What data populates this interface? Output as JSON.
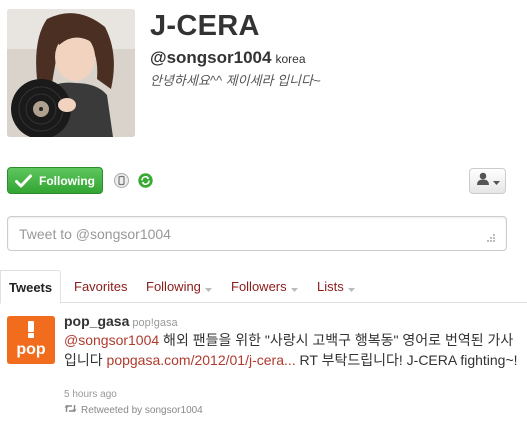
{
  "profile": {
    "name": "J-CERA",
    "handle": "@songsor1004",
    "location": "korea",
    "bio": "안녕하세요^^ 제이세라 입니다~"
  },
  "actions": {
    "follow_label": "Following",
    "follow_color": "#3aaa35"
  },
  "tweet_box": {
    "placeholder": "Tweet to @songsor1004"
  },
  "tabs": [
    {
      "label": "Tweets"
    },
    {
      "label": "Favorites"
    },
    {
      "label": "Following"
    },
    {
      "label": "Followers"
    },
    {
      "label": "Lists"
    }
  ],
  "tweet": {
    "avatar_text": "pop",
    "name": "pop_gasa",
    "handle": "pop!gasa",
    "mention": "@songsor1004",
    "text_part1": " 해외 팬들을 위한 \"사랑시 고백구 행복동\" 영어로 번역된 가사입니다 ",
    "link": "popgasa.com/2012/01/j-cera...",
    "text_part2": " RT 부탁드립니다! J-CERA fighting~!",
    "time": "5 hours ago",
    "retweet_label": "Retweeted by songsor1004"
  },
  "colors": {
    "link": "#b03a2e",
    "tab_link": "#8b1a1a",
    "pop_orange": "#f26c1e"
  },
  "icons": {
    "follow": "check-icon",
    "device": "phone-icon",
    "retweet": "retweet-icon",
    "user_menu": "person-icon"
  }
}
